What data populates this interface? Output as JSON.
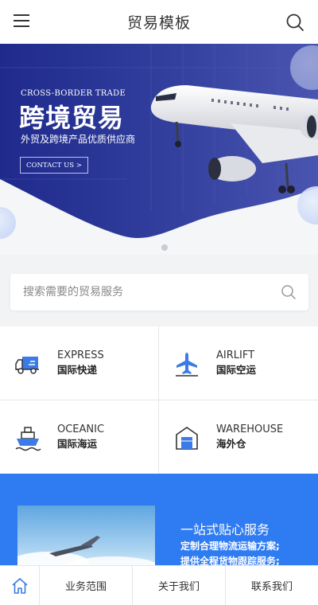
{
  "header": {
    "title": "贸易模板"
  },
  "banner": {
    "eyebrow": "CROSS-BORDER TRADE",
    "headline": "跨境贸易",
    "subtitle": "外贸及跨境产品优质供应商",
    "button_label": "CONTACT US >"
  },
  "search": {
    "placeholder": "搜索需要的贸易服务"
  },
  "services": [
    {
      "en": "EXPRESS",
      "cn": "国际快递",
      "icon": "truck-icon"
    },
    {
      "en": "AIRLIFT",
      "cn": "国际空运",
      "icon": "airplane-icon"
    },
    {
      "en": "OCEANIC",
      "cn": "国际海运",
      "icon": "ship-icon"
    },
    {
      "en": "WAREHOUSE",
      "cn": "海外仓",
      "icon": "warehouse-icon"
    }
  ],
  "feature": {
    "heading": "一站式贴心服务",
    "line1": "定制合理物流运输方案;",
    "line2": "提供全程货物跟踪服务;"
  },
  "bottom_nav": {
    "home_icon": "home-icon",
    "items": [
      "业务范围",
      "关于我们",
      "联系我们"
    ]
  },
  "colors": {
    "accent": "#2f7cf2",
    "banner_blue": "#2c3a9c",
    "icon_blue": "#3b7be8"
  }
}
